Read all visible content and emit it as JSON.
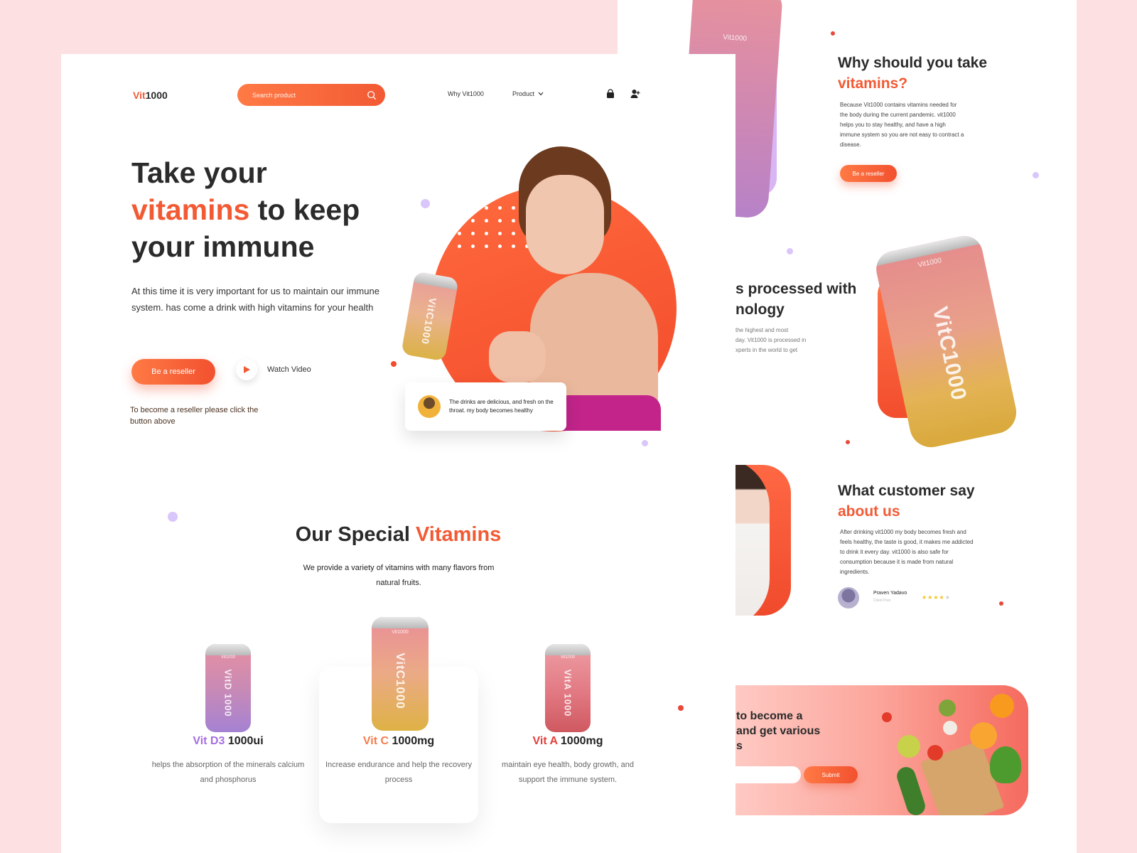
{
  "brand": {
    "prefix": "Vit",
    "suffix": "1000"
  },
  "search": {
    "placeholder": "Search product"
  },
  "nav": {
    "why": "Why Vit1000",
    "product": "Product"
  },
  "hero": {
    "line1": "Take your",
    "accent": "vitamins",
    "line2_rest": " to keep",
    "line3": "your immune",
    "paragraph": "At this time it is very important for us to maintain our immune system. has come a drink with high vitamins for your health",
    "cta": "Be a reseller",
    "watch": "Watch Video",
    "hint": "To become a reseller please click the button above",
    "quote": "The drinks are delicious, and fresh on the throat. my body becomes healthy",
    "can_label": "VitC1000"
  },
  "special": {
    "title_start": "Our Special ",
    "title_accent": "Vitamins",
    "subtitle": "We provide a variety of vitamins with many flavors from natural fruits.",
    "products": [
      {
        "accent": "Vit D3",
        "rest": " 1000ui",
        "desc": "helps the absorption of the minerals calcium and phosphorus",
        "can_label": "VitD 1000",
        "brand": "Vit1000"
      },
      {
        "accent": "Vit C",
        "rest": " 1000mg",
        "desc": "Increase endurance and help the recovery process",
        "can_label": "VitC1000",
        "brand": "Vit1000"
      },
      {
        "accent": "Vit A",
        "rest": " 1000mg",
        "desc": "maintain eye health, body growth, and support the immune system.",
        "can_label": "VitA 1000",
        "brand": "Vit1000"
      }
    ]
  },
  "why": {
    "title": "Why should you take",
    "accent": "vitamins?",
    "body": "Because Vit1000 contains vitamins needed for the body during the current pandemic. vit1000 helps you to stay healthy, and have a high immune system so you are not easy to contract a disease.",
    "cta": "Be a reseller",
    "can_brand": "Vit1000"
  },
  "processed": {
    "line1": "s processed with",
    "line2": "nology",
    "body_l1": "the highest and most",
    "body_l2": "day. Vit1000 is processed in",
    "body_l3": "xperts in the world to get",
    "can_brand": "Vit1000",
    "can_label": "VitC1000"
  },
  "testimonial": {
    "title": "What customer say",
    "accent": "about us",
    "body": "After drinking vit1000 my body becomes fresh and feels healthy, the taste is good, it makes me addicted to drink it every day. vit1000 is also safe for consumption because it is made from natural ingredients.",
    "name": "Praven Yadavo",
    "role": "Client Post",
    "rating": 4
  },
  "newsletter": {
    "line1": "to become a",
    "line2": "and get various",
    "line3": "s",
    "submit": "Submit"
  },
  "colors": {
    "accent": "#f25a34",
    "purple": "#a56ee0",
    "pink_bg": "#fde0e1"
  }
}
